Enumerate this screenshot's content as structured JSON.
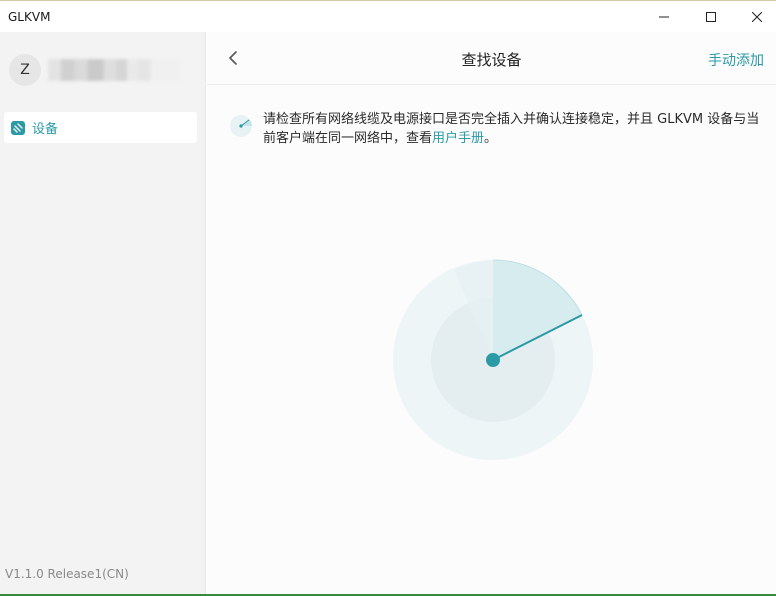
{
  "window": {
    "title": "GLKVM",
    "controls": [
      "minimize-icon",
      "maximize-icon",
      "close-icon"
    ]
  },
  "sidebar": {
    "avatar_initial": "Z",
    "items": [
      {
        "label": "设备",
        "icon": "device-scan-icon",
        "selected": true
      }
    ],
    "version": "V1.1.0 Release1(CN)"
  },
  "main": {
    "title": "查找设备",
    "manual_add_label": "手动添加",
    "notice": {
      "text": "请检查所有网络线缆及电源接口是否完全插入并确认连接稳定，并且 GLKVM 设备与当前客户端在同一网络中，查看",
      "link": "用户手册",
      "suffix": "。"
    }
  },
  "colors": {
    "accent": "#2a9aa6",
    "radar_fill": "#d7ecef"
  }
}
